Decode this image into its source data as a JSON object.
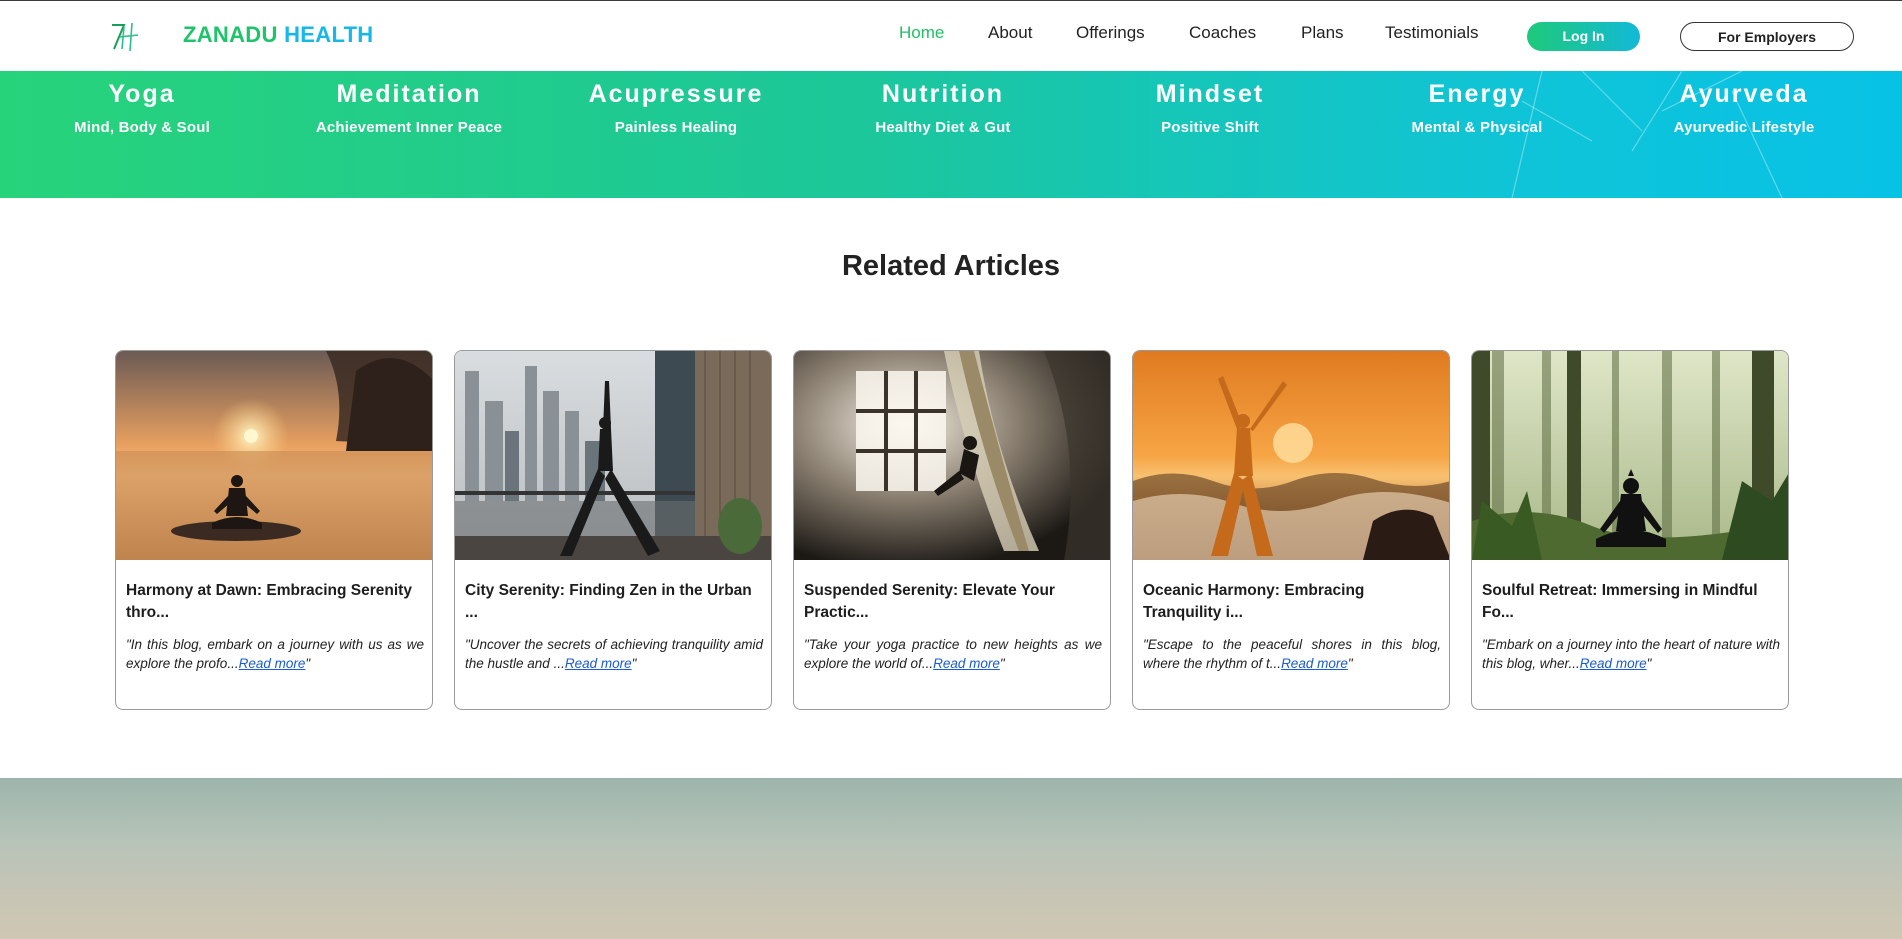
{
  "brand": {
    "part1": "ZANADU",
    "part2": "HEALTH",
    "logo_text": "ZH"
  },
  "nav": {
    "items": [
      {
        "label": "Home",
        "active": true
      },
      {
        "label": "About",
        "active": false
      },
      {
        "label": "Offerings",
        "active": false
      },
      {
        "label": "Coaches",
        "active": false
      },
      {
        "label": "Plans",
        "active": false
      },
      {
        "label": "Testimonials",
        "active": false
      }
    ],
    "login_label": "Log In",
    "employers_label": "For Employers"
  },
  "categories": [
    {
      "title": "Yoga",
      "subtitle": "Mind, Body & Soul"
    },
    {
      "title": "Meditation",
      "subtitle": "Achievement Inner Peace"
    },
    {
      "title": "Acupressure",
      "subtitle": "Painless Healing"
    },
    {
      "title": "Nutrition",
      "subtitle": "Healthy Diet & Gut"
    },
    {
      "title": "Mindset",
      "subtitle": "Positive Shift"
    },
    {
      "title": "Energy",
      "subtitle": "Mental & Physical"
    },
    {
      "title": "Ayurveda",
      "subtitle": "Ayurvedic Lifestyle"
    }
  ],
  "section": {
    "title": "Related Articles"
  },
  "articles": [
    {
      "title": "Harmony at Dawn: Embracing Serenity thro...",
      "excerpt": "\"In this blog, embark on a journey with us as we explore the profo...",
      "read_more": "Read more",
      "excerpt_end": "\"",
      "image": "sunrise-lake-meditation"
    },
    {
      "title": "City Serenity: Finding Zen in the Urban ...",
      "excerpt": "\"Uncover the secrets of achieving tranquility amid the hustle and ...",
      "read_more": "Read more",
      "excerpt_end": "\"",
      "image": "city-rooftop-yoga"
    },
    {
      "title": "Suspended Serenity: Elevate Your Practic...",
      "excerpt": "\"Take your yoga practice to new heights as we explore the world of...",
      "read_more": "Read more",
      "excerpt_end": "\"",
      "image": "aerial-yoga-window"
    },
    {
      "title": "Oceanic Harmony: Embracing Tranquility i...",
      "excerpt": "\"Escape to the peaceful shores in this blog, where the rhythm of t...",
      "read_more": "Read more",
      "excerpt_end": "\"",
      "image": "ocean-sunset-yoga"
    },
    {
      "title": "Soulful Retreat: Immersing in Mindful Fo...",
      "excerpt": "\"Embark on a journey into the heart of nature with this blog, wher...",
      "read_more": "Read more",
      "excerpt_end": "\"",
      "image": "forest-meditation"
    }
  ],
  "colors": {
    "accent_green": "#1fbf63",
    "accent_cyan": "#17b8e8",
    "link_blue": "#1a5bd6"
  }
}
